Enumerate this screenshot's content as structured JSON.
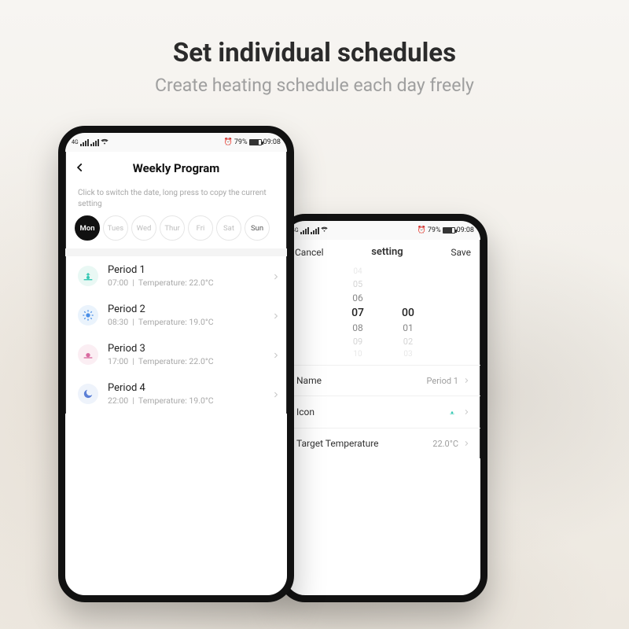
{
  "marketing": {
    "headline": "Set individual schedules",
    "subhead": "Create heating schedule each day freely"
  },
  "status": {
    "battery_pct": "79%",
    "time": "09:08",
    "alarm_icon": "alarm"
  },
  "phone1": {
    "title": "Weekly Program",
    "hint": "Click to switch the date, long press to copy the current setting",
    "days": [
      {
        "label": "Mon",
        "active": true
      },
      {
        "label": "Tues",
        "active": false
      },
      {
        "label": "Wed",
        "active": false
      },
      {
        "label": "Thur",
        "active": false
      },
      {
        "label": "Fri",
        "active": false
      },
      {
        "label": "Sat",
        "active": false
      },
      {
        "label": "Sun",
        "active": false
      }
    ],
    "periods": [
      {
        "name": "Period 1",
        "time": "07:00",
        "temp": "22.0°C",
        "icon": "sunrise"
      },
      {
        "name": "Period 2",
        "time": "08:30",
        "temp": "19.0°C",
        "icon": "sun"
      },
      {
        "name": "Period 3",
        "time": "17:00",
        "temp": "22.0°C",
        "icon": "sunset"
      },
      {
        "name": "Period 4",
        "time": "22:00",
        "temp": "19.0°C",
        "icon": "moon"
      }
    ]
  },
  "phone2": {
    "cancel": "Cancel",
    "title": "setting",
    "save": "Save",
    "picker": {
      "hours": {
        "faint1": "04",
        "faint2": "05",
        "near_above": "06",
        "selected": "07",
        "near_below": "08",
        "faint_below1": "09",
        "faint_below2": "10"
      },
      "minutes": {
        "selected": "00",
        "near_below": "01",
        "faint_below1": "02",
        "faint_below2": "03"
      }
    },
    "rows": {
      "name_label": "Name",
      "name_value": "Period 1",
      "icon_label": "Icon",
      "icon_value": "sunrise",
      "temp_label": "Target Temperature",
      "temp_value": "22.0°C"
    }
  }
}
